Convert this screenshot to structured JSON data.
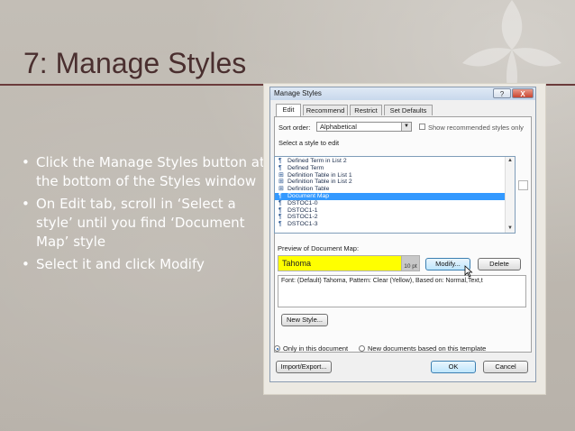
{
  "slide": {
    "title": "7: Manage Styles",
    "bullets": [
      "Click the Manage Styles button at the bottom of the Styles window",
      "On Edit tab, scroll in ‘Select a style’ until you find ‘Document Map’ style",
      "Select it and click Modify"
    ]
  },
  "dialog": {
    "title": "Manage Styles",
    "help_label": "?",
    "close_label": "X",
    "tabs": [
      "Edit",
      "Recommend",
      "Restrict",
      "Set Defaults"
    ],
    "sort_label": "Sort order:",
    "sort_value": "Alphabetical",
    "show_recommended_label": "Show recommended styles only",
    "select_style_label": "Select a style to edit",
    "styles": [
      {
        "icon": "¶",
        "label": "Defined Term in List 2"
      },
      {
        "icon": "¶",
        "label": "Defined Term"
      },
      {
        "icon": "⊞",
        "label": "Definition Table in List 1"
      },
      {
        "icon": "⊞",
        "label": "Definition Table in List 2"
      },
      {
        "icon": "⊞",
        "label": "Definition Table"
      },
      {
        "icon": "¶",
        "label": "Document Map"
      },
      {
        "icon": "¶",
        "label": "DSTOC1-0"
      },
      {
        "icon": "¶",
        "label": "DSTOC1-1"
      },
      {
        "icon": "¶",
        "label": "DSTOC1-2"
      },
      {
        "icon": "¶",
        "label": "DSTOC1-3"
      }
    ],
    "selected_style": "Document Map",
    "preview_label": "Preview of Document Map:",
    "preview_font": "Tahoma",
    "preview_size": "10 pt",
    "modify_label": "Modify...",
    "delete_label": "Delete",
    "description": "Font: (Default) Tahoma, Pattern: Clear (Yellow), Based on: Normal,Text,t",
    "new_style_label": "New Style...",
    "only_this_doc_label": "Only in this document",
    "new_docs_label": "New documents based on this template",
    "import_export_label": "Import/Export...",
    "ok_label": "OK",
    "cancel_label": "Cancel"
  },
  "colors": {
    "title": "#4a2f2f",
    "selection": "#3399ff",
    "preview_highlight": "#ffff00"
  }
}
